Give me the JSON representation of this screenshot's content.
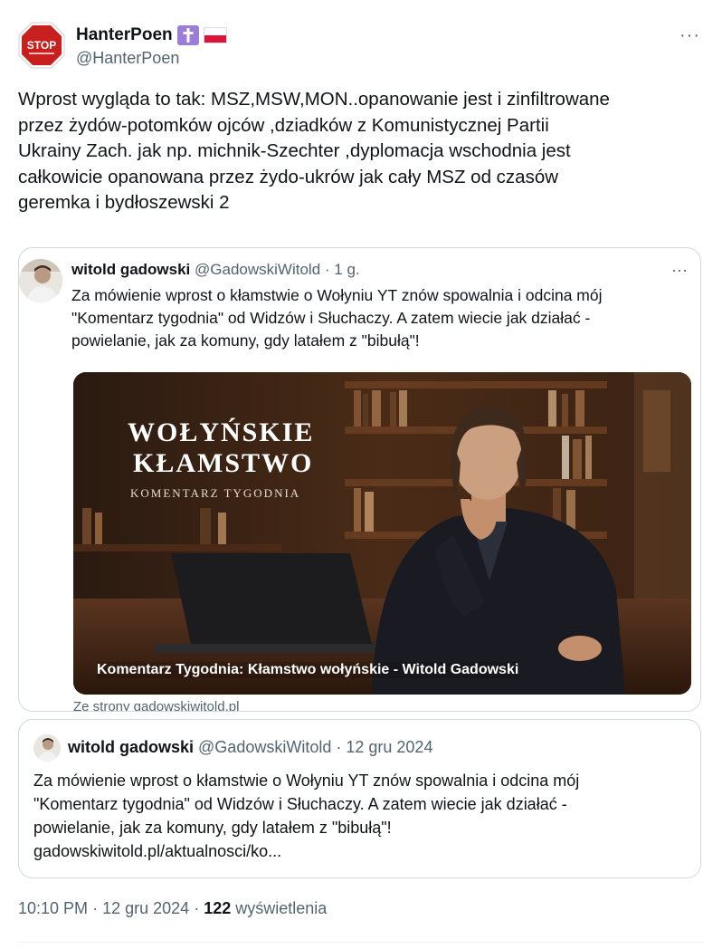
{
  "author": {
    "display_name": "HanterPoen",
    "handle": "@HanterPoen",
    "avatar_text": "STOP",
    "badges": [
      "cross-icon",
      "poland-flag-icon"
    ]
  },
  "tweet": {
    "text": "Wprost wygląda to tak: MSZ,MSW,MON..opanowanie jest i zinfiltrowane\nprzez żydów-potomków ojców ,dziadków z Komunistycznej Partii\nUkrainy Zach. jak np. michnik-Szechter ,dyplomacja wschodnia jest\ncałkowicie opanowana przez żydo-ukrów jak cały MSZ od czasów\ngeremka i bydłoszewski 2"
  },
  "quoted": {
    "name": "witold gadowski",
    "handle": "@GadowskiWitold",
    "time": "· 1 g.",
    "text": "Za mówienie wprost o kłamstwie o Wołyniu YT znów spowalnia i odcina mój\n\"Komentarz tygodnia\" od Widzów i Słuchaczy. A zatem wiecie jak działać -\npowielanie, jak za komuny, gdy latałem z \"bibułą\"!",
    "media": {
      "title_line1": "WOŁYŃSKIE",
      "title_line2": "KŁAMSTWO",
      "subtitle": "KOMENTARZ TYGODNIA",
      "caption": "Komentarz Tygodnia: Kłamstwo wołyńskie - Witold Gadowski"
    },
    "source": "Ze strony gadowskiwitold.pl"
  },
  "linked": {
    "name": "witold gadowski",
    "handle": "@GadowskiWitold",
    "time": "· 12 gru 2024",
    "text": "Za mówienie wprost o kłamstwie o Wołyniu YT znów spowalnia i odcina mój\n\"Komentarz tygodnia\" od Widzów i Słuchaczy. A zatem wiecie jak działać -\npowielanie, jak za komuny, gdy latałem z \"bibułą\"!\ngadowskiwitold.pl/aktualnosci/ko..."
  },
  "meta": {
    "time": "10:10 PM",
    "date": "12 gru 2024",
    "views_count": "122",
    "views_label": "wyświetlenia"
  },
  "colors": {
    "stop_red": "#c8201f",
    "cross_badge": "#9b7cd6",
    "flag_red": "#dc143c"
  }
}
